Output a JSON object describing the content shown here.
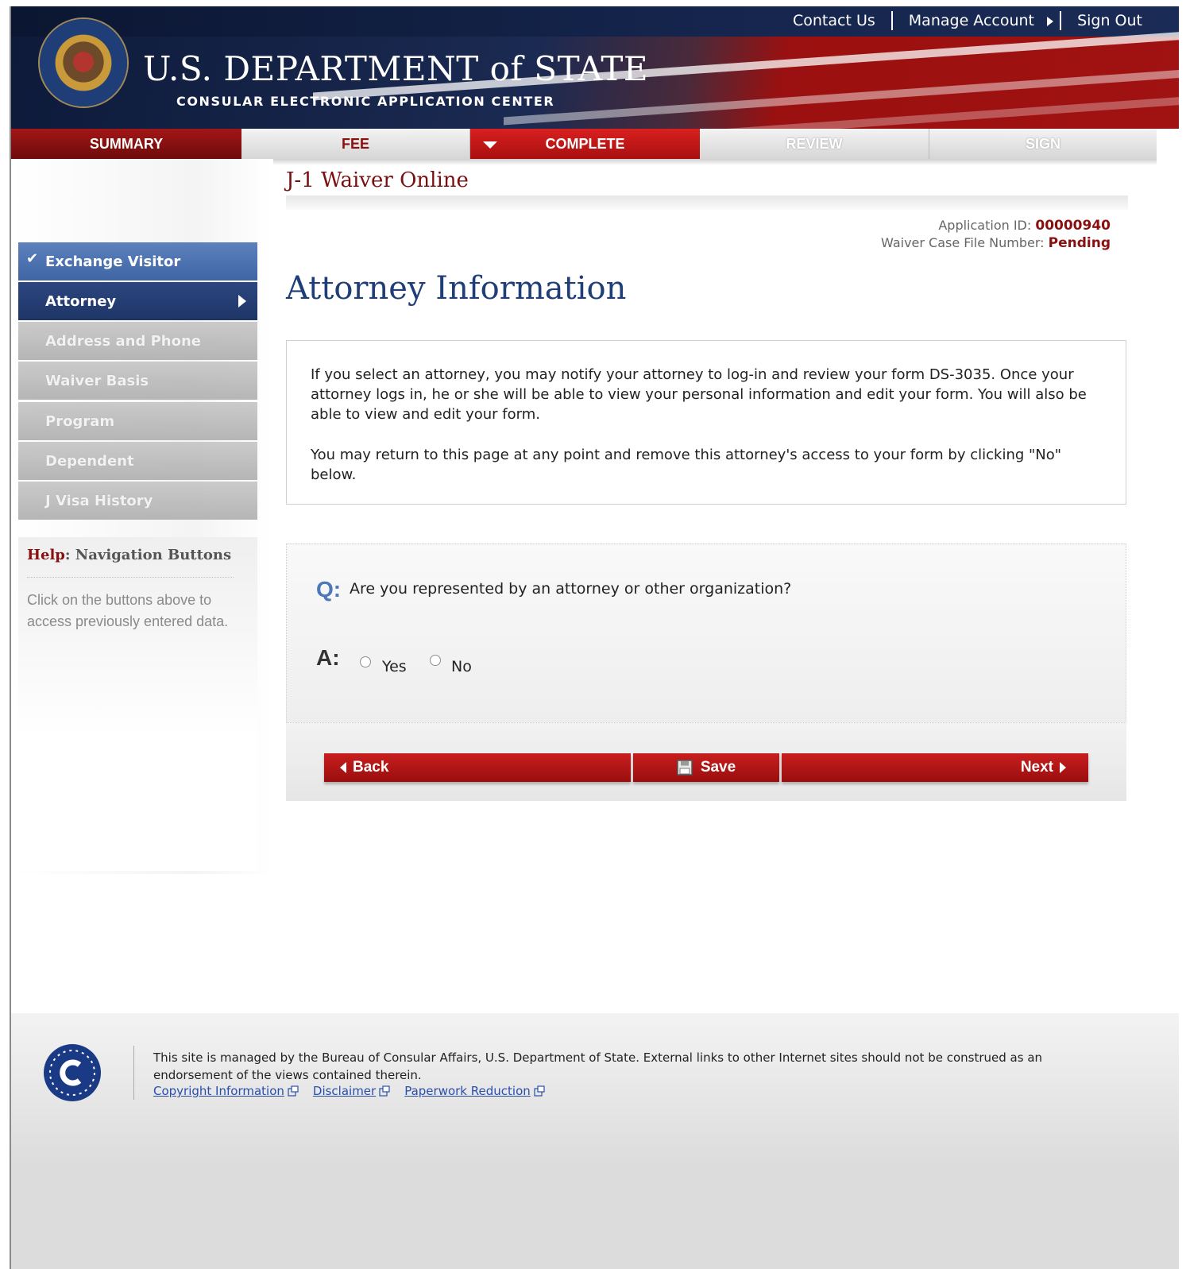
{
  "header": {
    "org_title": "U.S. DEPARTMENT of STATE",
    "org_subtitle": "CONSULAR ELECTRONIC APPLICATION CENTER",
    "links": {
      "contact": "Contact Us",
      "manage": "Manage Account",
      "signout": "Sign Out"
    }
  },
  "tabs": {
    "summary": "SUMMARY",
    "fee": "FEE",
    "complete": "COMPLETE",
    "review": "REVIEW",
    "sign": "SIGN"
  },
  "sidebar": {
    "items": [
      {
        "label": "Exchange Visitor",
        "state": "done"
      },
      {
        "label": "Attorney",
        "state": "active"
      },
      {
        "label": "Address and Phone",
        "state": "disabled"
      },
      {
        "label": "Waiver Basis",
        "state": "disabled"
      },
      {
        "label": "Program",
        "state": "disabled"
      },
      {
        "label": "Dependent",
        "state": "disabled"
      },
      {
        "label": "J Visa History",
        "state": "disabled"
      }
    ],
    "help_prefix": "Help",
    "help_title": ": Navigation Buttons",
    "help_text": "Click on the buttons above to access previously entered data."
  },
  "main": {
    "app_title": "J-1 Waiver Online",
    "app_id_label": "Application ID:",
    "app_id_value": "00000940",
    "case_label": "Waiver Case File Number:",
    "case_value": "Pending",
    "page_title": "Attorney Information",
    "info_p1": "If you select an attorney, you may notify your attorney to log-in and review your form DS-3035. Once your attorney logs in, he or she will be able to view your personal information and edit your form. You will also be able to view and edit your form.",
    "info_p2": "You may return to this page at any point and remove this attorney's access to your form by clicking \"No\" below.",
    "q_label": "Q:",
    "question": "Are you represented by an attorney or other organization?",
    "a_label": "A:",
    "options": [
      "Yes",
      "No"
    ],
    "buttons": {
      "back": "Back",
      "save": "Save",
      "next": "Next"
    }
  },
  "footer": {
    "text": "This site is managed by the Bureau of Consular Affairs, U.S. Department of State. External links to other Internet sites should not be construed as an endorsement of the views contained therein.",
    "links": [
      "Copyright Information",
      "Disclaimer",
      "Paperwork Reduction"
    ]
  },
  "colors": {
    "brand_red": "#a21616",
    "nav_blue": "#1e3566",
    "title_blue": "#1f3e78"
  }
}
